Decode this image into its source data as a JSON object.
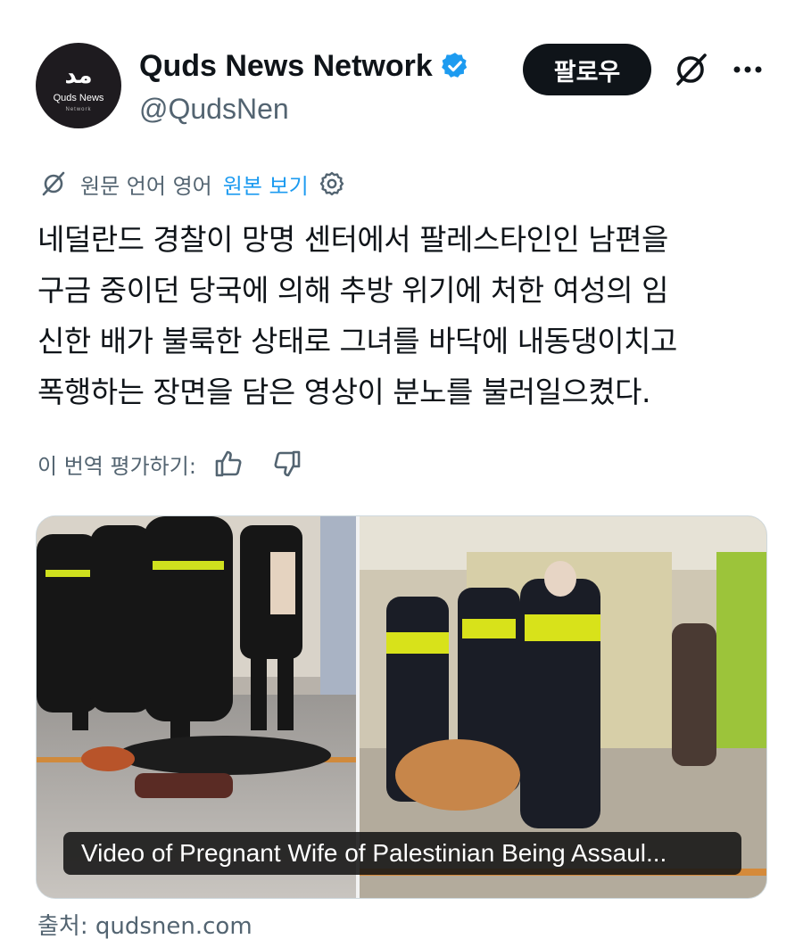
{
  "account": {
    "avatar_logo": "ﻣﺪ",
    "avatar_subtitle": "Quds News",
    "avatar_tiny": "Network",
    "display_name": "Quds News Network",
    "verified": true,
    "handle": "@QudsNen"
  },
  "actions": {
    "follow_label": "팔로우",
    "grok_icon": "grok-icon",
    "more_icon": "more-icon"
  },
  "translation": {
    "info_text": "원문 언어 영어",
    "view_original_label": "원본 보기"
  },
  "tweet": {
    "lines": [
      "네덜란드 경찰이 망명 센터에서 팔레스타인인 남편을",
      "구금 중이던 당국에 의해 추방 위기에 처한 여성의 임",
      "신한 배가 불룩한 상태로 그녀를 바닥에 내동댕이치고",
      "폭행하는 장면을 담은 영상이 분노를 불러일으켰다."
    ]
  },
  "rating": {
    "label": "이 번역 평가하기:"
  },
  "media": {
    "caption": "Video of Pregnant Wife of Palestinian Being Assaul..."
  },
  "source": {
    "text": "출처: qudsnen.com"
  },
  "colors": {
    "accent": "#1d9bf0",
    "muted": "#536471",
    "text": "#0f1419",
    "police_vest": "#d8e21a"
  }
}
